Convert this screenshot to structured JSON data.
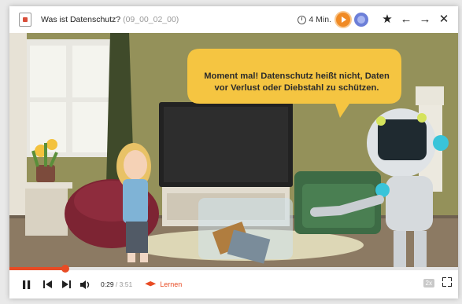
{
  "header": {
    "title": "Was ist Datenschutz?",
    "code": "(09_00_02_00)",
    "duration": "4 Min.",
    "icons": [
      "document-icon",
      "clock-icon",
      "play-circle-icon",
      "brain-icon",
      "star-icon",
      "back-arrow-icon",
      "forward-arrow-icon",
      "close-icon"
    ]
  },
  "video": {
    "speech": "Moment mal! Datenschutz heißt nicht, Daten vor Verlust oder Diebstahl zu schützen."
  },
  "player": {
    "current_time": "0:29",
    "separator": " / ",
    "total_time": "3:51",
    "progress_fraction": 0.125,
    "learn_label": "Lernen",
    "speed": "2x",
    "accent_color": "#e84b24"
  }
}
